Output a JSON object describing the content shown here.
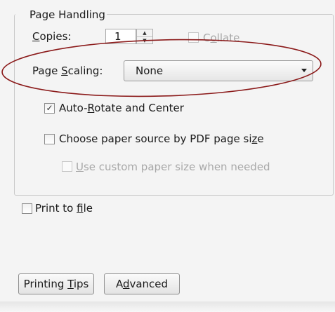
{
  "group": {
    "title": "Page Handling"
  },
  "copies": {
    "label_pre": "",
    "label_u": "C",
    "label_post": "opies:",
    "value": "1"
  },
  "collate": {
    "label_pre": "C",
    "label_u": "o",
    "label_post": "llate",
    "checked": false,
    "enabled": false
  },
  "page_scaling": {
    "label_pre": "Page ",
    "label_u": "S",
    "label_post": "caling:",
    "selected": "None"
  },
  "auto_rotate": {
    "label_pre": "Auto-",
    "label_u": "R",
    "label_post": "otate and Center",
    "checked": true,
    "mark": "✓"
  },
  "paper_source": {
    "label_pre": "Choose paper source by PDF page si",
    "label_u": "z",
    "label_post": "e",
    "checked": false
  },
  "custom_paper": {
    "label_pre": "",
    "label_u": "U",
    "label_post": "se custom paper size when needed",
    "checked": false,
    "enabled": false
  },
  "print_to_file": {
    "label_pre": "Print to ",
    "label_u": "f",
    "label_post": "ile",
    "checked": false
  },
  "buttons": {
    "tips_pre": "Printing ",
    "tips_u": "T",
    "tips_post": "ips",
    "advanced_pre": "A",
    "advanced_u": "d",
    "advanced_post": "vanced"
  },
  "annotation": {
    "color": "#8b1a1a",
    "shape": "ellipse"
  }
}
